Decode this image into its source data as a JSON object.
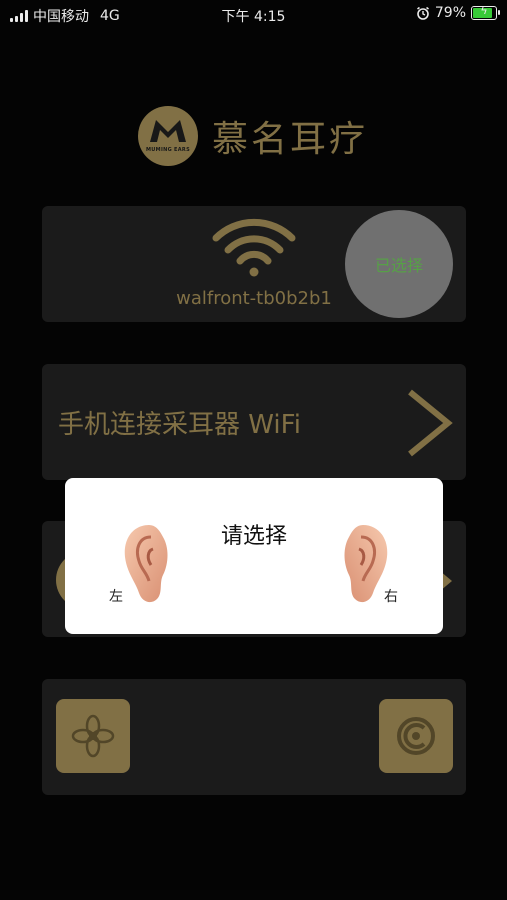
{
  "status_bar": {
    "carrier": "中国移动",
    "network": "4G",
    "time": "下午 4:15",
    "battery_percent": "79%",
    "battery_level": 0.79
  },
  "app": {
    "logo_badge_text": "MUMING EARS",
    "title": "慕名耳疗"
  },
  "wifi_card": {
    "network_name": "walfront-tb0b2b1",
    "selected_label": "已选择"
  },
  "connect_card": {
    "label": "手机连接采耳器 WiFi"
  },
  "dialog": {
    "title": "请选择",
    "left_label": "左",
    "right_label": "右"
  },
  "icons": {
    "wifi": "wifi-icon",
    "chevron": "chevron-right-icon",
    "alarm": "alarm-icon",
    "battery": "battery-charging-icon",
    "flower": "flower-icon",
    "refresh": "refresh-icon"
  },
  "colors": {
    "accent_gold": "#8c7a4b",
    "card_bg": "#1e1e1e",
    "selected_text": "#5fae4e"
  }
}
